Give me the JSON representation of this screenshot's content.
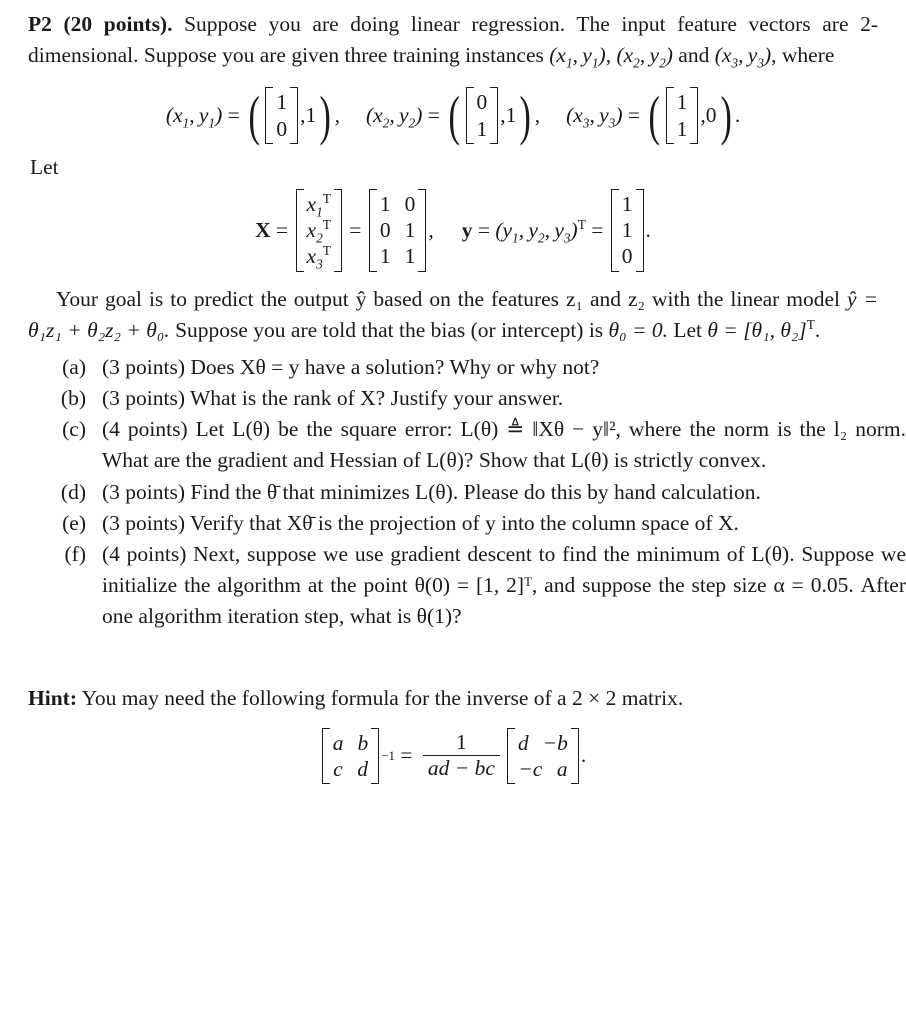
{
  "problem": {
    "label": "P2 (20 points).",
    "intro_line1": "Suppose you are doing linear regression. The input feature",
    "intro_line2": "vectors are 2-dimensional. Suppose you are given three training instances",
    "intro_line3_prefix": "",
    "intro_line3_suffix": ", where",
    "and_word": "and",
    "let_word": "Let"
  },
  "instances": [
    {
      "name_x": "x",
      "name_x_sub": "1",
      "name_y": "y",
      "name_y_sub": "1",
      "vector": [
        "1",
        "0"
      ],
      "scalar": "1",
      "trailing": ","
    },
    {
      "name_x": "x",
      "name_x_sub": "2",
      "name_y": "y",
      "name_y_sub": "2",
      "vector": [
        "0",
        "1"
      ],
      "scalar": "1",
      "trailing": ","
    },
    {
      "name_x": "x",
      "name_x_sub": "3",
      "name_y": "y",
      "name_y_sub": "3",
      "vector": [
        "1",
        "1"
      ],
      "scalar": "0",
      "trailing": "."
    }
  ],
  "design": {
    "X_symbol": "X",
    "equals": "=",
    "row_symbols": [
      {
        "base": "x",
        "sub": "1",
        "sup": "T"
      },
      {
        "base": "x",
        "sub": "2",
        "sup": "T"
      },
      {
        "base": "x",
        "sub": "3",
        "sup": "T"
      }
    ],
    "X_matrix": [
      [
        "1",
        "0"
      ],
      [
        "0",
        "1"
      ],
      [
        "1",
        "1"
      ]
    ],
    "comma": ",",
    "y_symbol": "y",
    "y_tuple_open": "(",
    "y_tuple": "y₁, y₂, y₃",
    "y_tuple_close": ")",
    "y_transpose": "T",
    "y_vector": [
      "1",
      "1",
      "0"
    ],
    "period": "."
  },
  "goal": {
    "line1": "Your goal is to predict the output ŷ based on the features z₁ and z₂ with",
    "line2_a": "the linear model ŷ = θ",
    "line2_b": "Suppose you are told that the bias",
    "line3_a": "(or intercept) is θ₀ = 0. Let θ = [θ₁, θ₂]",
    "model_expr": "ŷ = θ₁z₁ + θ₂z₂ + θ₀.",
    "bias_expr": "θ₀ = 0.",
    "theta_def": "θ = [θ₁, θ₂]"
  },
  "questions": [
    {
      "label": "(a)",
      "points": "(3 points)",
      "text_parts": [
        "Does ",
        "Xθ = y",
        " have a solution? Why or why not?"
      ],
      "plain": "(3 points) Does Xθ = y have a solution? Why or why not?"
    },
    {
      "label": "(b)",
      "points": "(3 points)",
      "plain": "(3 points) What is the rank of X? Justify your answer."
    },
    {
      "label": "(c)",
      "points": "(4 points)",
      "plain": "(4 points) Let L(θ) be the square error: L(θ) ≜ ‖Xθ − y‖², where the norm is the l₂ norm. What are the gradient and Hessian of L(θ)? Show that L(θ) is strictly convex."
    },
    {
      "label": "(d)",
      "points": "(3 points)",
      "plain": "(3 points) Find the θ̄ that minimizes L(θ). Please do this by hand calculation."
    },
    {
      "label": "(e)",
      "points": "(3 points)",
      "plain": "(3 points) Verify that Xθ̄ is the projection of y into the column space of X."
    },
    {
      "label": "(f)",
      "points": "(4 points)",
      "plain": "(4 points) Next, suppose we use gradient descent to find the minimum of L(θ). Suppose we initialize the algorithm at the point θ(0) = [1, 2]ᵀ, and suppose the step size α = 0.05. After one algorithm iteration step, what is θ(1)?"
    }
  ],
  "hint": {
    "label": "Hint:",
    "text": "You may need the following formula for the inverse of a 2 × 2 matrix.",
    "matrix": [
      [
        "a",
        "b"
      ],
      [
        "c",
        "d"
      ]
    ],
    "exponent": "−1",
    "equals": "=",
    "frac_num": "1",
    "frac_den": "ad − bc",
    "inv_matrix": [
      [
        "d",
        "−b"
      ],
      [
        "−c",
        "a"
      ]
    ],
    "period": "."
  },
  "colors": {
    "page_background": "#ffffff",
    "text": "#1a1a1a"
  }
}
